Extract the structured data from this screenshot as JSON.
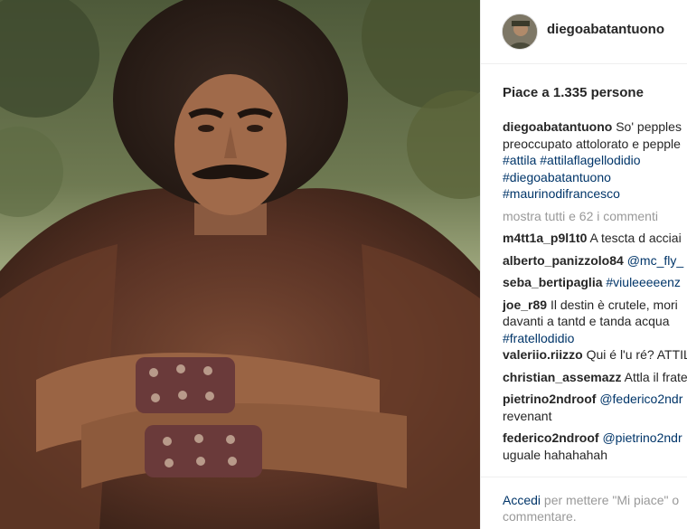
{
  "post": {
    "username": "diegoabatantuono",
    "likes_text": "Piace a 1.335 persone",
    "caption": {
      "username": "diegoabatantuono",
      "text_line1": "So' pepples",
      "text_line2": "preoccupato attolorato e pepple",
      "hashtags_line3": "#attila #attilaflagellodidio",
      "hashtags_line4": "#diegoabatantuono",
      "hashtags_line5": "#maurinodifrancesco"
    },
    "view_all_comments": "mostra tutti e 62 i commenti"
  },
  "comments": [
    {
      "user": "m4tt1a_p9l1t0",
      "text": "A tescta d acciai"
    },
    {
      "user": "alberto_panizzolo84",
      "mention": "@mc_fly_"
    },
    {
      "user": "seba_bertipaglia",
      "tag": "#viuleeeeenz"
    },
    {
      "user": "joe_r89",
      "text": "Il destin è crutele, mori",
      "line2": "davanti a tantd e tanda acqua",
      "tag_line3": "#fratellodidio"
    },
    {
      "user": "valeriio.riizzo",
      "text": "Qui é l'u ré? ATTIL"
    },
    {
      "user": "christian_assemazz",
      "text": "Attla il frate"
    },
    {
      "user": "pietrino2ndroof",
      "mention": "@federico2ndr",
      "line2": "revenant"
    },
    {
      "user": "federico2ndroof",
      "mention": "@pietrino2ndr",
      "line2": "uguale hahahahah"
    }
  ],
  "login_prompt": {
    "link": "Accedi",
    "text": " per mettere \"Mi piace\" o",
    "line2": "commentare."
  },
  "icons": {
    "avatar": "profile-avatar"
  },
  "colors": {
    "link": "#003569",
    "muted": "#999999",
    "text": "#262626"
  }
}
